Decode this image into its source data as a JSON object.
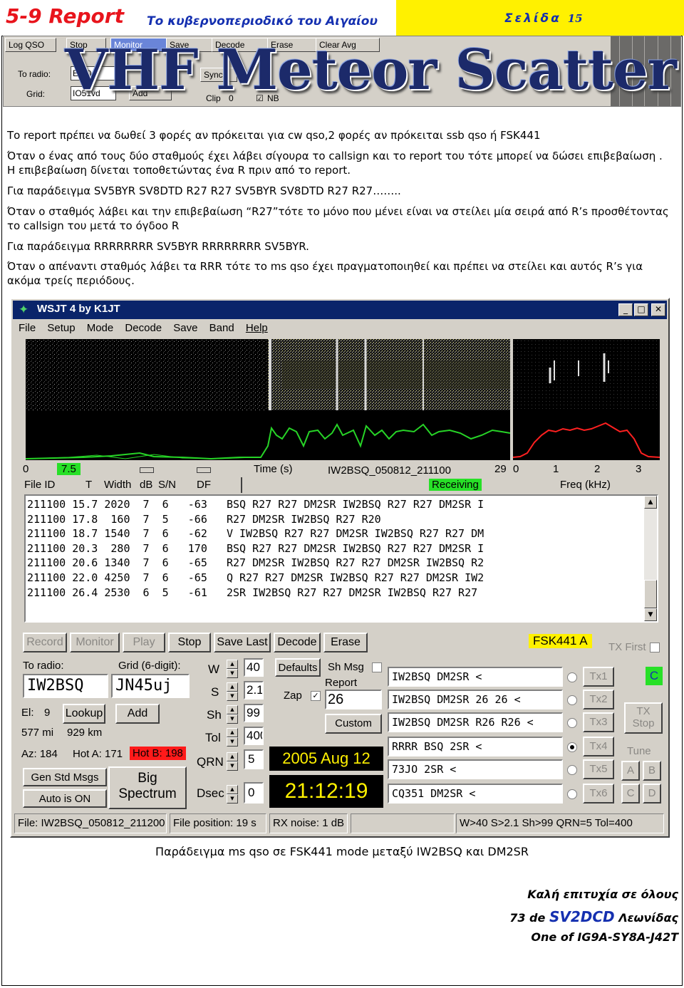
{
  "header": {
    "section": "5-9 Report",
    "subtitle": "Το κυβερνοπεριοδικό του Αιγαίου",
    "page_label": "Σελίδα",
    "page_number": "15"
  },
  "banner": {
    "title": "VHF Meteor Scatter",
    "buttons": [
      "Log QSO",
      "Stop",
      "Monitor",
      "Save",
      "Decode",
      "Erase",
      "Clear Avg"
    ],
    "to_radio_label": "To radio:",
    "to_radio_value": "EI4D",
    "grid_label": "Grid:",
    "grid_value": "IO51vd",
    "add_button": "Add",
    "sync_label": "Sync",
    "clip_label": "Clip",
    "clip_value": "0",
    "nb_label": "NB"
  },
  "body": {
    "p1": "Το report πρέπει να δωθεί 3 φορές αν πρόκειται για cw qso,2 φορές αν πρόκειται ssb qso ή FSK441",
    "p2": "Όταν ο ένας από τους δύο σταθμούς έχει λάβει σίγουρα το callsign και το report του τότε μπορεί να δώσει επιβεβαίωση . Η επιβεβαίωση δίνεται τοποθετώντας ένα R πριν από το report.",
    "p3": "Για παράδειγμα SV5BYR SV8DTD R27 R27 SV5BYR SV8DTD R27 R27……..",
    "p4": "Όταν ο σταθμός λάβει και την επιβεβαίωση “R27”τότε το μόνο που μένει είναι να στείλει μία σειρά από R’s προσθέτοντας το callsign του μετά το όγδοο R",
    "p5": "Για παράδειγμα RRRRRRRR SV5BYR RRRRRRRR SV5BYR.",
    "p6": "Όταν ο απέναντι σταθμός λάβει τα RRR τότε το ms qso έχει πραγματοποιηθεί και πρέπει να στείλει και αυτός R’s για ακόμα τρείς περιόδους."
  },
  "wsjt": {
    "title": "WSJT 4    by K1JT",
    "menu": [
      "File",
      "Setup",
      "Mode",
      "Decode",
      "Save",
      "Band",
      "Help"
    ],
    "time_axis": {
      "start": "0",
      "marker": "7.5",
      "label": "Time (s)",
      "file": "IW2BSQ_050812_211100",
      "end": "29"
    },
    "freq_axis": {
      "ticks": [
        "0",
        "1",
        "2",
        "3"
      ],
      "label": "Freq (kHz)"
    },
    "columns": [
      "File ID",
      "T",
      "Width",
      "dB",
      "S/N",
      "DF"
    ],
    "receiving": "Receiving",
    "decodes": [
      [
        "211100",
        "15.7",
        "2020",
        "7",
        "6",
        "-63",
        "BSQ R27 R27 DM2SR IW2BSQ R27 R27 DM2SR I"
      ],
      [
        "211100",
        "17.8",
        "160",
        "7",
        "5",
        "-66",
        "R27 DM2SR IW2BSQ R27 R20"
      ],
      [
        "211100",
        "18.7",
        "1540",
        "7",
        "6",
        "-62",
        "V IW2BSQ R27 R27 DM2SR IW2BSQ R27 R27 DM"
      ],
      [
        "211100",
        "20.3",
        "280",
        "7",
        "6",
        "170",
        "BSQ R27 R27 DM2SR IW2BSQ R27 R27 DM2SR I"
      ],
      [
        "211100",
        "20.6",
        "1340",
        "7",
        "6",
        "-65",
        "R27 DM2SR IW2BSQ R27 R27 DM2SR IW2BSQ R2"
      ],
      [
        "211100",
        "22.0",
        "4250",
        "7",
        "6",
        "-65",
        "Q R27 R27 DM2SR IW2BSQ R27 R27 DM2SR IW2"
      ],
      [
        "211100",
        "26.4",
        "2530",
        "6",
        "5",
        "-61",
        "2SR IW2BSQ R27 R27 DM2SR IW2BSQ R27 R27"
      ]
    ],
    "buttons": [
      "Record",
      "Monitor",
      "Play",
      "Stop",
      "Save Last",
      "Decode",
      "Erase"
    ],
    "mode": "FSK441 A",
    "tx_first": "TX First",
    "to_radio_label": "To radio:",
    "to_radio": "IW2BSQ",
    "grid_label": "Grid (6-digit):",
    "grid": "JN45uj",
    "el_label": "El:",
    "el": "9",
    "lookup": "Lookup",
    "add": "Add",
    "dist_mi": "577 mi",
    "dist_km": "929 km",
    "az": "Az: 184",
    "hot_a": "Hot A: 171",
    "hot_b": "Hot B: 198",
    "gen_std": "Gen Std Msgs",
    "auto": "Auto is ON",
    "big_spectrum": "Big Spectrum",
    "params": [
      {
        "label": "W",
        "value": "40"
      },
      {
        "label": "S",
        "value": "2.1"
      },
      {
        "label": "Sh",
        "value": "99"
      },
      {
        "label": "Tol",
        "value": "400"
      },
      {
        "label": "QRN",
        "value": "5"
      },
      {
        "label": "Dsec",
        "value": "0"
      }
    ],
    "defaults": "Defaults",
    "sh_msg": "Sh Msg",
    "zap": "Zap",
    "report_label": "Report",
    "report": "26",
    "custom": "Custom",
    "date": "2005 Aug 12",
    "time": "21:12:19",
    "tx_msgs": [
      "IW2BSQ DM2SR <",
      "IW2BSQ DM2SR 26 26 <",
      "IW2BSQ DM2SR R26 R26 <",
      "RRRR BSQ 2SR <",
      "73JO 2SR <",
      "CQ351 DM2SR <"
    ],
    "tx_buttons": [
      "Tx1",
      "Tx2",
      "Tx3",
      "Tx4",
      "Tx5",
      "Tx6"
    ],
    "tx_stop": "TX Stop",
    "tune": "Tune",
    "abcd": [
      "A",
      "B",
      "C",
      "D"
    ],
    "c_indicator": "C",
    "status": {
      "file": "File: IW2BSQ_050812_211200",
      "pos": "File position: 19 s",
      "rx": "RX noise: 1 dB",
      "params": "W>40  S>2.1  Sh>99  QRN=5  Tol=400"
    }
  },
  "footer": {
    "caption": "Παράδειγμα ms qso σε FSK441 mode μεταξύ IW2BSQ και DM2SR",
    "sig1": "Καλή επιτυχία σε όλους",
    "sig2_pre": "73 de",
    "sig2_call": "SV2DCD",
    "sig2_name": "Λεωνίδας",
    "sig3": "One of IG9A-SY8A-J42T"
  }
}
